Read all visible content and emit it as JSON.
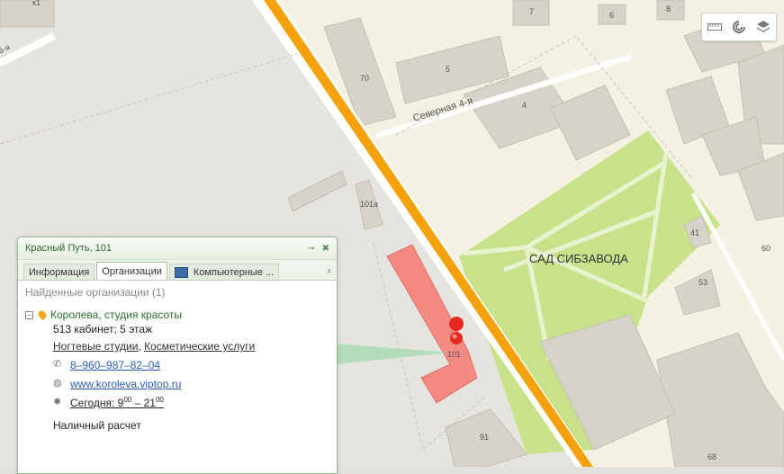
{
  "map": {
    "street_label": "Северная 4-я",
    "garden_label": "САД СИБЗАВОДА",
    "building_numbers": [
      "6",
      "7",
      "8",
      "70",
      "5",
      "4",
      "101а",
      "41",
      "60",
      "53",
      "101",
      "91",
      "68",
      "6-я",
      "к1"
    ]
  },
  "toolbar": {
    "ruler_icon": "ruler-icon",
    "traffic_icon": "traffic-icon",
    "layers_icon": "layers-icon"
  },
  "popup": {
    "title": "Красный Путь, 101",
    "tabs": [
      "Информация",
      "Организации",
      "Компьютерные ..."
    ],
    "found_label": "Найденные организации (1)",
    "org": {
      "name": "Королева, студия красоты",
      "office": "513 кабинет; 5 этаж",
      "category_1": "Ногтевые студии",
      "category_2": "Косметические услуги",
      "phone": "8‒960‒987‒82‒04",
      "website": "www.koroleva.viptop.ru",
      "hours_prefix": "Сегодня: 9",
      "hours_open_min": "00",
      "hours_dash": " – 21",
      "hours_close_min": "00",
      "payment": "Наличный расчет"
    }
  },
  "colors": {
    "road_main": "#f5a20a",
    "park": "#c7e28b",
    "building": "#d8d3c8",
    "highlight": "#f48a82"
  }
}
